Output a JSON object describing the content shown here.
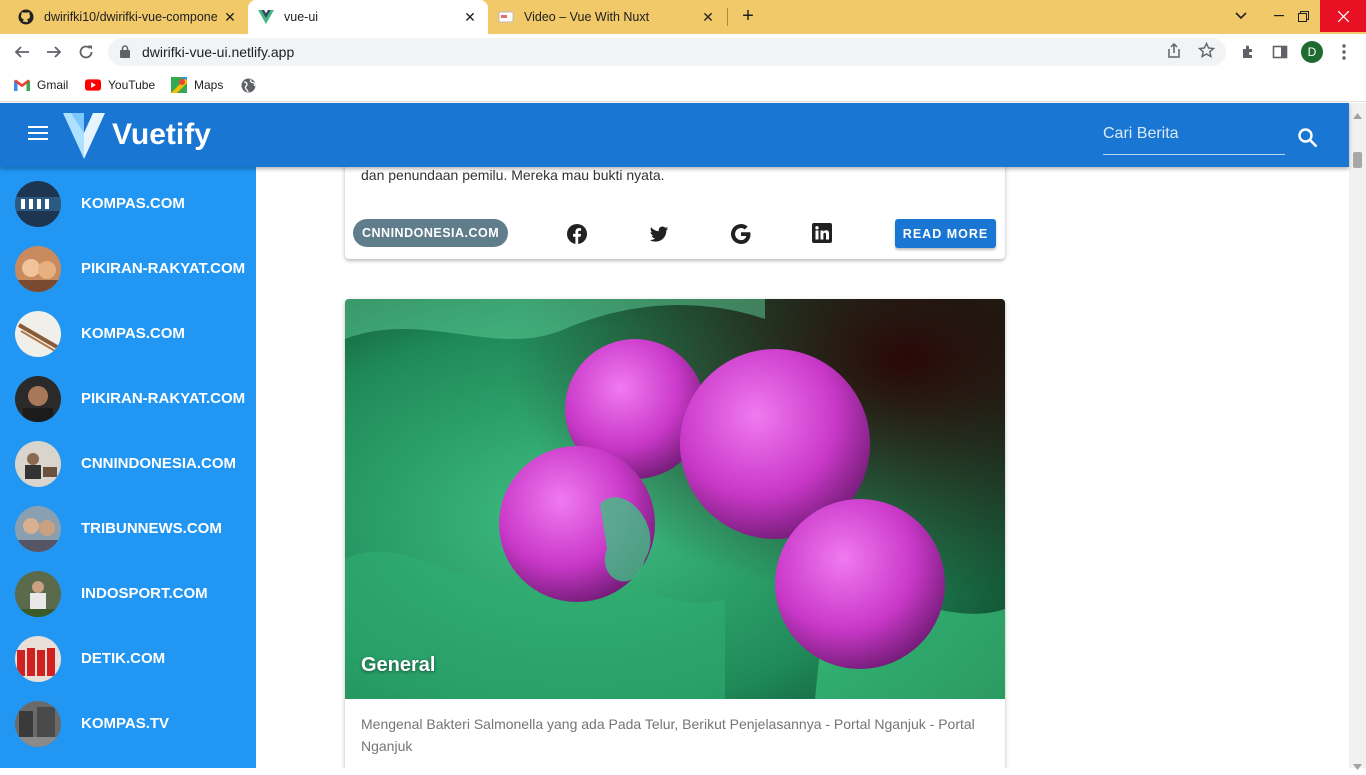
{
  "browser": {
    "tabs": [
      {
        "title": "dwirifki10/dwirifki-vue-compone",
        "favicon": "github-icon"
      },
      {
        "title": "vue-ui",
        "favicon": "vue-icon"
      },
      {
        "title": "Video – Vue With Nuxt",
        "favicon": "video-icon"
      }
    ],
    "url": "dwirifki-vue-ui.netlify.app",
    "profile_initial": "D",
    "bookmarks": [
      {
        "label": "Gmail",
        "icon": "gmail-icon"
      },
      {
        "label": "YouTube",
        "icon": "youtube-icon"
      },
      {
        "label": "Maps",
        "icon": "maps-icon"
      }
    ]
  },
  "app": {
    "brand": "Vuetify",
    "search_placeholder": "Cari Berita",
    "colors": {
      "appbar": "#1976d2",
      "drawer": "#2196f3",
      "chip": "#607d8b"
    }
  },
  "drawer": {
    "items": [
      {
        "label": "KOMPAS.COM"
      },
      {
        "label": "PIKIRAN-RAKYAT.COM"
      },
      {
        "label": "KOMPAS.COM"
      },
      {
        "label": "PIKIRAN-RAKYAT.COM"
      },
      {
        "label": "CNNINDONESIA.COM"
      },
      {
        "label": "TRIBUNNEWS.COM"
      },
      {
        "label": "INDOSPORT.COM"
      },
      {
        "label": "DETIK.COM"
      },
      {
        "label": "KOMPAS.TV"
      }
    ]
  },
  "cards": [
    {
      "text": "dan penundaan pemilu. Mereka mau bukti nyata.",
      "source": "CNNINDONESIA.COM",
      "read_more": "READ MORE"
    },
    {
      "category": "General",
      "text": "Mengenal Bakteri Salmonella yang ada Pada Telur, Berikut Penjelasannya - Portal Nganjuk - Portal Nganjuk"
    }
  ]
}
